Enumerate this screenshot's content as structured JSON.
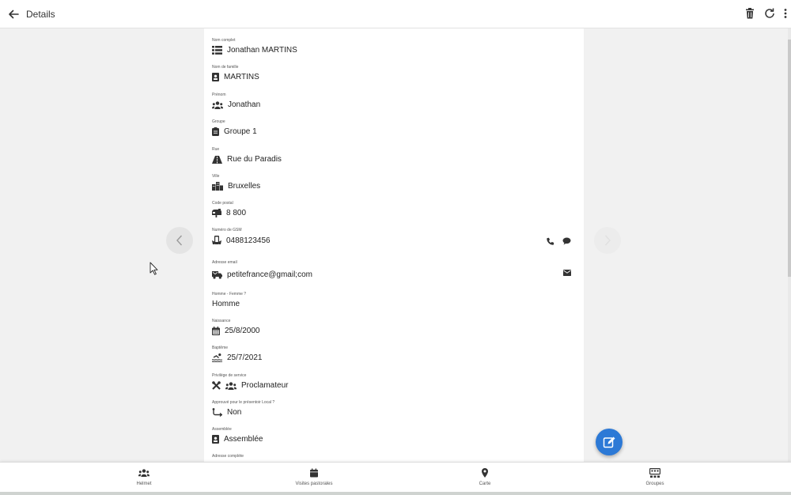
{
  "appbar": {
    "title": "Details",
    "actions": [
      "trash-icon",
      "refresh-icon",
      "more-vertical-icon"
    ]
  },
  "fields": [
    {
      "label": "Nom complet",
      "value": "Jonathan MARTINS",
      "icon": "list-icon"
    },
    {
      "label": "Nom de famille",
      "value": "MARTINS",
      "icon": "id-badge-icon"
    },
    {
      "label": "Prénom",
      "value": "Jonathan",
      "icon": "users-icon"
    },
    {
      "label": "Groupe",
      "value": "Groupe 1",
      "icon": "clipboard-icon"
    },
    {
      "label": "Rue",
      "value": "Rue du Paradis",
      "icon": "road-icon"
    },
    {
      "label": "Ville",
      "value": "Bruxelles",
      "icon": "city-icon"
    },
    {
      "label": "Code postal",
      "value": "8 800",
      "icon": "mailbox-icon"
    },
    {
      "label": "Numéro de GSM",
      "value": "0488123456",
      "icon": "phone-hand-icon",
      "actions": [
        "phone-icon",
        "message-icon"
      ]
    },
    {
      "label": "Adresse email",
      "value": "petitefrance@gmail;com",
      "icon": "mail-truck-icon",
      "actions": [
        "envelope-icon"
      ]
    },
    {
      "label": "Homme - Femme ?",
      "value": "Homme",
      "icon": ""
    },
    {
      "label": "Naissance",
      "value": "25/8/2000",
      "icon": "calendar-icon"
    },
    {
      "label": "Baptême",
      "value": "25/7/2021",
      "icon": "swimmer-icon"
    },
    {
      "label": "Privilège de service",
      "value": "Proclamateur",
      "icon": "tools-icon"
    },
    {
      "label": "Approuvé pour le présentoir Local ?",
      "value": "Non",
      "icon": "route-icon"
    },
    {
      "label": "Assemblée",
      "value": "Assemblée",
      "icon": "id-badge-icon"
    },
    {
      "label": "Adresse complète",
      "value": "",
      "icon": ""
    }
  ],
  "nav": {
    "prev": "chevron-left-icon",
    "next": "chevron-right-icon"
  },
  "fab": {
    "icon": "edit-icon"
  },
  "colors": {
    "accent": "#2c79d6",
    "background": "#f1f1f1",
    "panel": "#ffffff"
  },
  "bottom_nav": [
    {
      "label": "Helmet",
      "icon": "users-icon"
    },
    {
      "label": "Visites pastorales",
      "icon": "calendar-icon"
    },
    {
      "label": "Carte",
      "icon": "map-pin-icon"
    },
    {
      "label": "Groupes",
      "icon": "groups-icon"
    }
  ]
}
